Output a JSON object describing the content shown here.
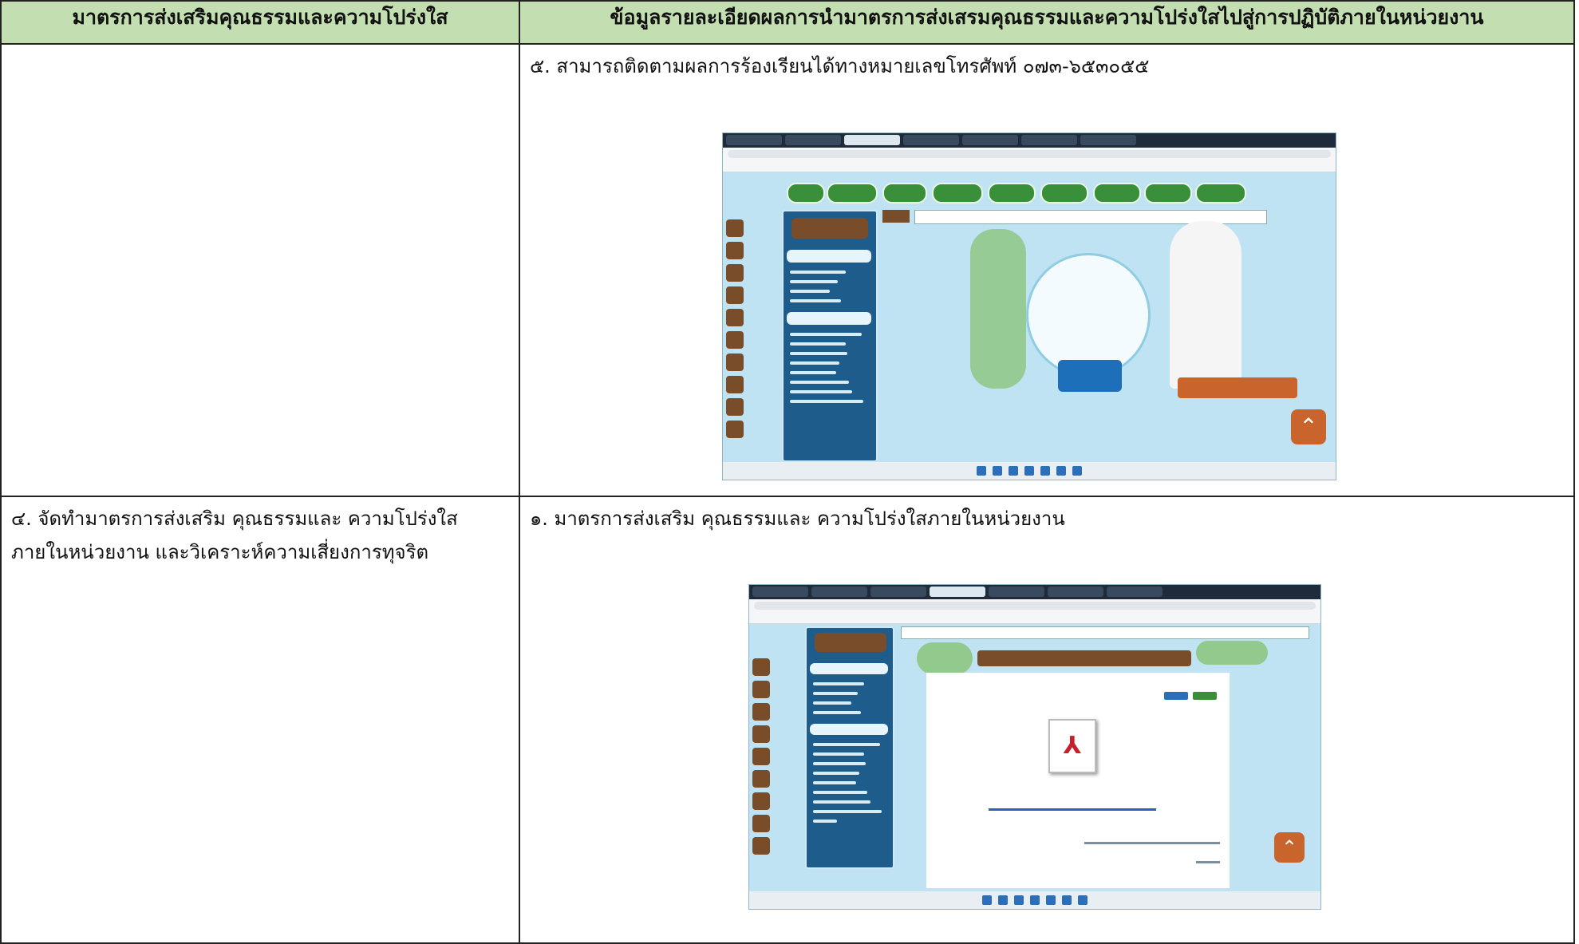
{
  "table": {
    "headers": [
      "มาตรการส่งเสริมคุณธรรมและความโปร่งใส",
      "ข้อมูลรายละเอียดผลการนำมาตรการส่งเสรมคุณธรรมและความโปร่งใสไปสู่การปฏิบัติภายในหน่วยงาน"
    ],
    "rows": [
      {
        "measure": "",
        "detail": "๕. สามารถติดตามผลการร้องเรียนได้ทางหมายเลขโทรศัพท์ ๐๗๓-๖๕๓๐๕๕"
      },
      {
        "measure_line1": "๔. จัดทำมาตรการส่งเสริม คุณธรรมและ ความโปร่งใส",
        "measure_line2": "ภายในหน่วยงาน และวิเคราะห์ความเสี่ยงการทุจริต",
        "detail": "๑. มาตรการส่งเสริม คุณธรรมและ ความโปร่งใสภายในหน่วยงาน"
      }
    ]
  },
  "colors": {
    "header_bg": "#c3deb0",
    "site_bg": "#bfe3f2",
    "menu_bg": "#1e5c8c",
    "accent_brown": "#7a4d2a",
    "nav_green": "#3a8f3a"
  }
}
